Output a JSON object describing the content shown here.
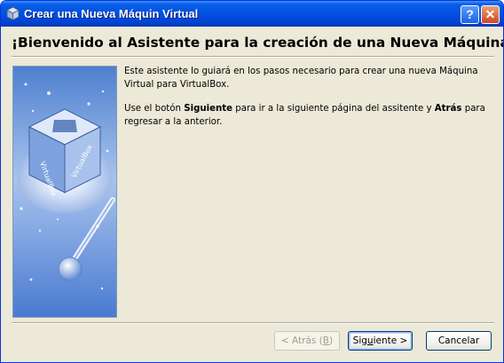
{
  "window": {
    "title": "Crear una Nueva Máquin Virtual",
    "help_button": "?",
    "close_button": "✕"
  },
  "heading": "¡Bienvenido al Asistente para la creación de una Nueva Máquina Virtual!",
  "intro": {
    "p1": "Este asistente lo guiará en los pasos necesario para crear una nueva Máquina Virtual para VirtualBox.",
    "p2_start": "Use el botón ",
    "p2_next": "Siguiente",
    "p2_mid": " para ir a la siguiente página del assitente y ",
    "p2_back": "Atrás",
    "p2_end": " para regresar a la anterior."
  },
  "side_image": {
    "label_front": "VirtualBox",
    "label_side": "VirtualBox"
  },
  "buttons": {
    "back_pre": "< Atrás (",
    "back_key": "B",
    "back_post": ")",
    "next_pre": "Sig",
    "next_key": "u",
    "next_post": "iente >",
    "cancel": "Cancelar"
  },
  "colors": {
    "titlebar": "#0254e6",
    "dialog_bg": "#ece9d8",
    "image_bg": "#5f8bd6"
  }
}
